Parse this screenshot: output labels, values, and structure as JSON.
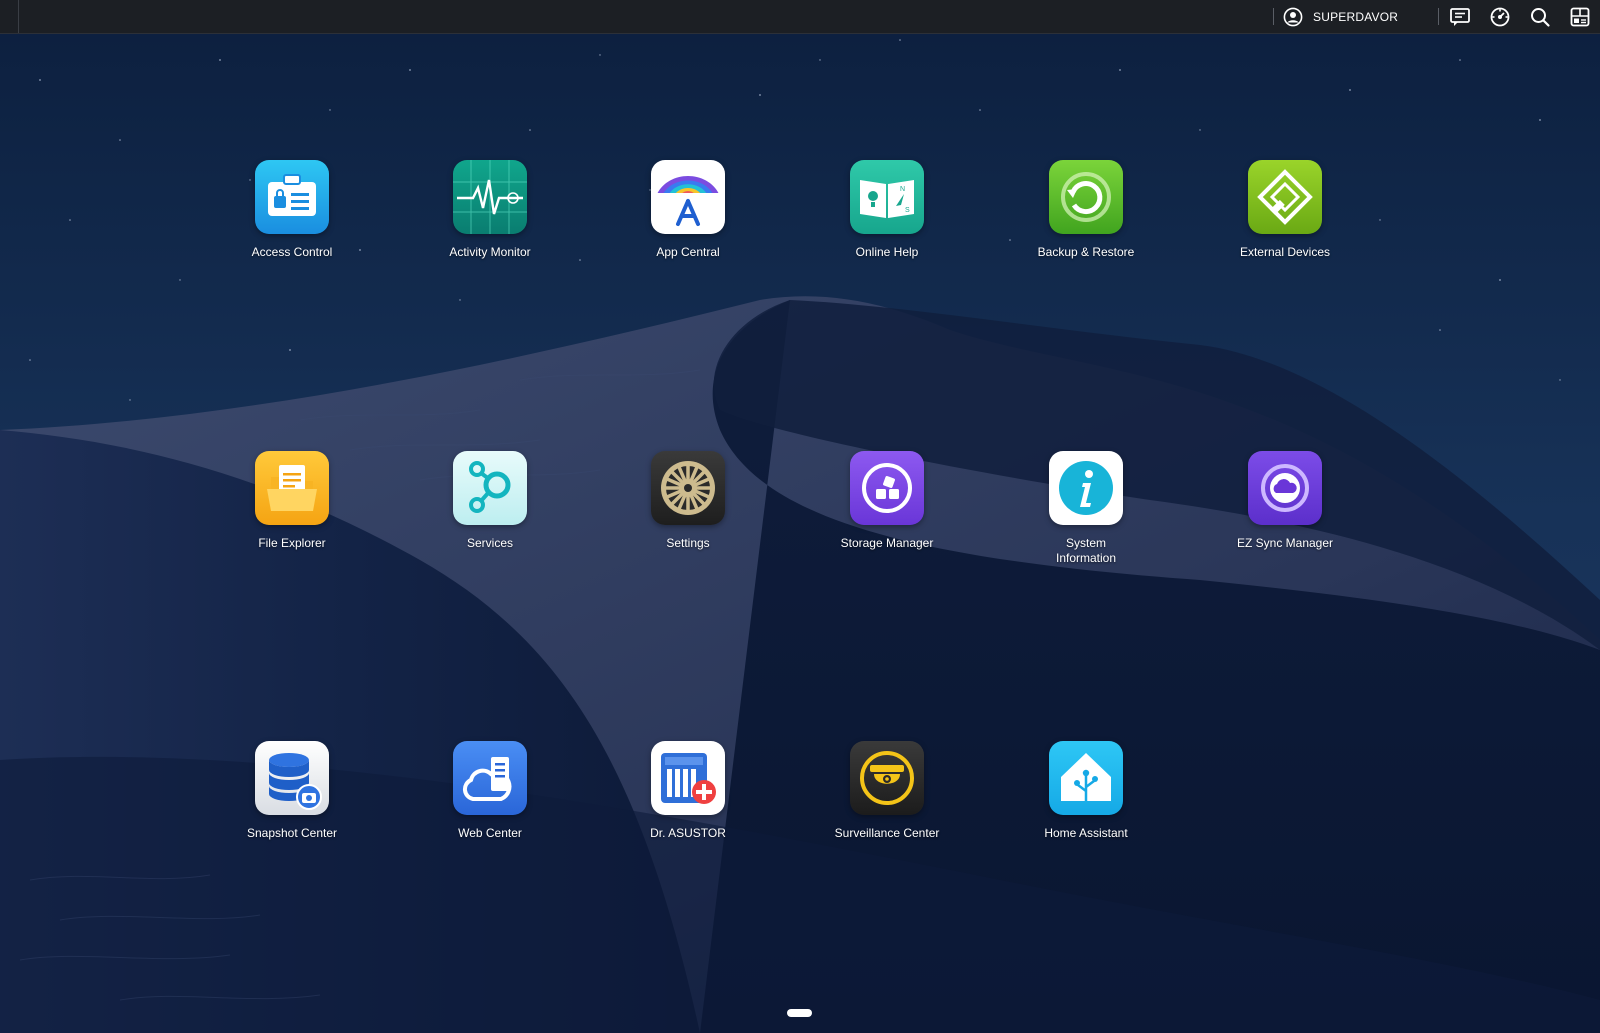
{
  "topbar": {
    "username": "SUPERDAVOR"
  },
  "icons": {
    "user": "user-circle-icon",
    "messages": "message-icon",
    "monitor": "gauge-icon",
    "search": "search-icon",
    "widgets": "widgets-icon"
  },
  "apps": {
    "access_control": "Access Control",
    "activity_monitor": "Activity Monitor",
    "app_central": "App Central",
    "online_help": "Online Help",
    "backup_restore": "Backup & Restore",
    "external_devices": "External Devices",
    "file_explorer": "File Explorer",
    "services": "Services",
    "settings": "Settings",
    "storage_manager": "Storage Manager",
    "system_information": "System Information",
    "ez_sync": "EZ Sync Manager",
    "snapshot_center": "Snapshot Center",
    "web_center": "Web Center",
    "dr_asustor": "Dr. ASUSTOR",
    "surveillance": "Surveillance Center",
    "home_assistant": "Home Assistant"
  },
  "colors": {
    "sky_top": "#0d2040",
    "dune_shadow": "#0a1530",
    "topbar": "#1c1f24"
  }
}
